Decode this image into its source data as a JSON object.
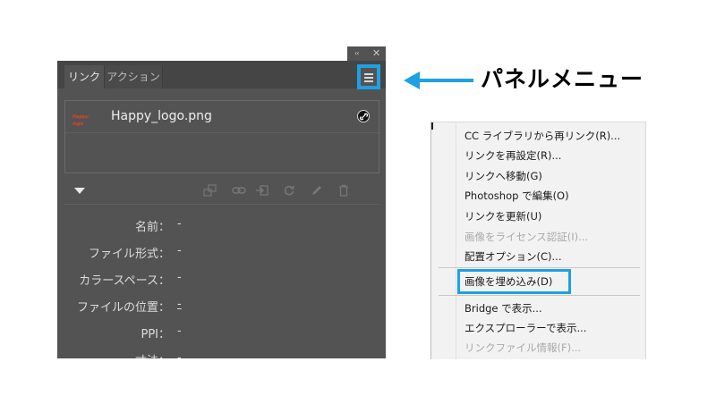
{
  "panel": {
    "collapse_glyph": "‹‹",
    "close_glyph": "✕",
    "tabs": [
      {
        "label": "リンク"
      },
      {
        "label": "アクション"
      }
    ],
    "link": {
      "thumbnail_text": "Happy logo",
      "filename": "Happy_logo.png"
    },
    "info": [
      {
        "label": "名前：",
        "value": "-"
      },
      {
        "label": "ファイル形式：",
        "value": "-"
      },
      {
        "label": "カラースペース：",
        "value": "-"
      },
      {
        "label": "ファイルの位置：",
        "value": "-"
      },
      {
        "label": "PPI：",
        "value": "-"
      },
      {
        "label": "寸法：",
        "value": "-"
      }
    ]
  },
  "callout": {
    "label": "パネルメニュー"
  },
  "context_menu": {
    "items": [
      {
        "label": "CC ライブラリから再リンク(R)...",
        "enabled": true
      },
      {
        "label": "リンクを再設定(R)...",
        "enabled": true
      },
      {
        "label": "リンクへ移動(G)",
        "enabled": true
      },
      {
        "label": "Photoshop で編集(O)",
        "enabled": true
      },
      {
        "label": "リンクを更新(U)",
        "enabled": true
      },
      {
        "label": "画像をライセンス認証(I)...",
        "enabled": false
      },
      {
        "label": "配置オプション(C)...",
        "enabled": true
      },
      {
        "label": "画像を埋め込み(D)",
        "enabled": true
      },
      {
        "label": "Bridge で表示...",
        "enabled": true
      },
      {
        "label": "エクスプローラーで表示...",
        "enabled": true
      },
      {
        "label": "リンクファイル情報(F)...",
        "enabled": false
      }
    ]
  },
  "colors": {
    "accent": "#1ea1e3",
    "panel_bg": "#535353"
  }
}
